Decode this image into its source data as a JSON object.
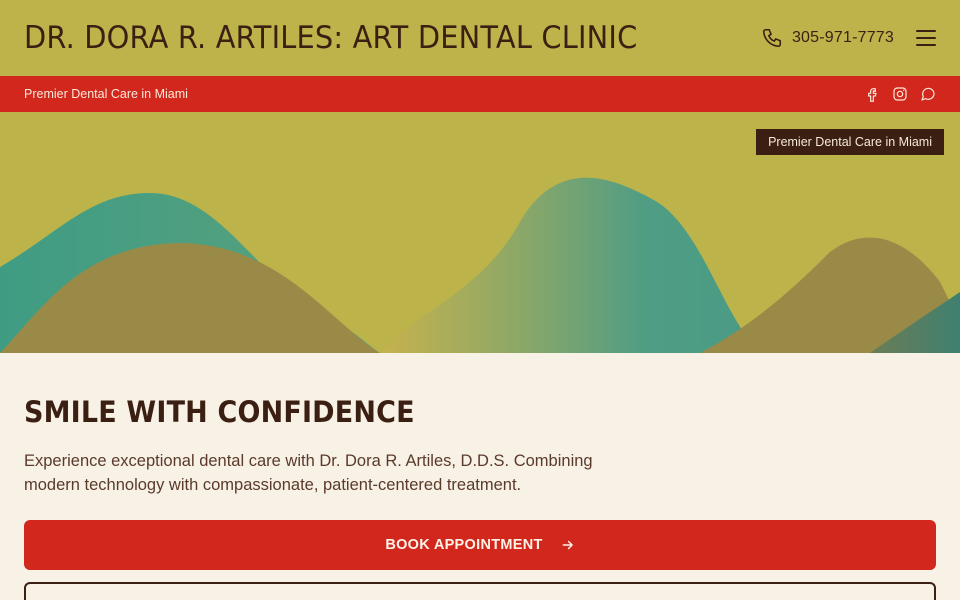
{
  "header": {
    "title": "DR. DORA R. ARTILES: ART DENTAL CLINIC",
    "phone": "305-971-7773",
    "phone_icon": "phone-icon",
    "menu_icon": "hamburger-menu-icon"
  },
  "redbar": {
    "tagline": "Premier Dental Care in Miami",
    "social_icons": [
      "facebook-icon",
      "instagram-icon",
      "chat-icon"
    ]
  },
  "hero": {
    "badge": "Premier Dental Care in Miami"
  },
  "main": {
    "headline": "SMILE WITH CONFIDENCE",
    "intro": "Experience exceptional dental care with Dr. Dora R. Artiles, D.D.S. Combining modern technology with compassionate, patient-centered treatment.",
    "book_label": "BOOK APPOINTMENT"
  },
  "colors": {
    "header_bg": "#bcb34b",
    "accent_red": "#d1271d",
    "text_dark": "#3b1f12",
    "page_bg": "#f8f1e6"
  }
}
